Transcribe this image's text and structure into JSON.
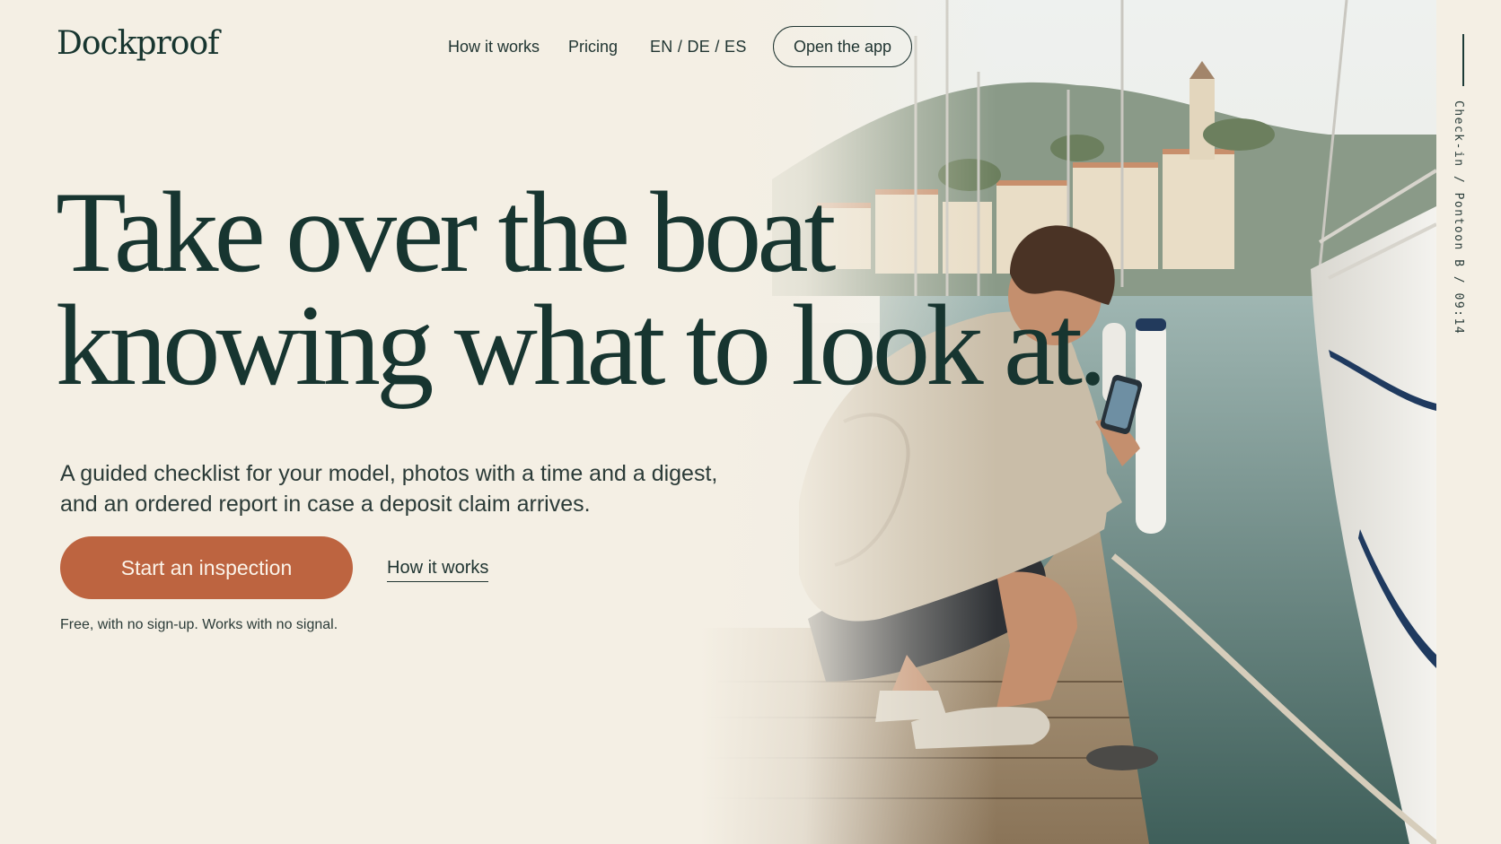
{
  "header": {
    "logo": "Dockproof",
    "nav": {
      "how_it_works": "How it works",
      "pricing": "Pricing",
      "languages": "EN / DE / ES"
    },
    "open_app": "Open the app"
  },
  "hero": {
    "headline": [
      "Take over the boat",
      "knowing what to look at."
    ],
    "subheadline": [
      "A guided checklist for your model, photos with a time and a digest,",
      "and an ordered report in case a deposit claim arrives."
    ],
    "primary_cta": "Start an inspection",
    "secondary_cta": "How it works",
    "note": "Free, with no sign-up. Works with no signal."
  },
  "side_label": "Check-in / Pontoon B / 09:14",
  "colors": {
    "background": "#f4efe4",
    "ink": "#173530",
    "accent": "#bd6440"
  }
}
